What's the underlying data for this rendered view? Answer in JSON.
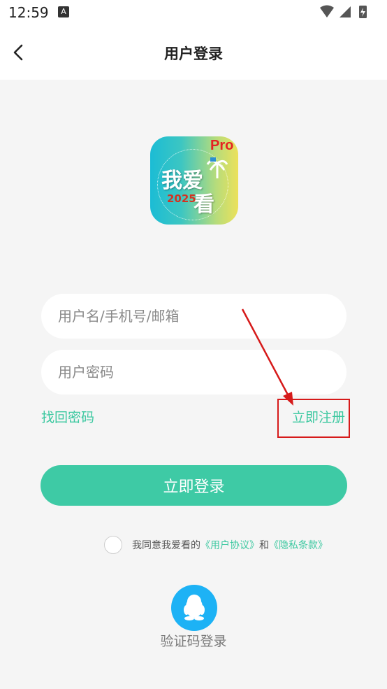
{
  "status_bar": {
    "time": "12:59",
    "notification_letter": "A"
  },
  "header": {
    "title": "用户登录"
  },
  "logo": {
    "pro_text": "Pro",
    "text_line1": "我爱",
    "text_line2": "看",
    "year": "2025"
  },
  "form": {
    "username_placeholder": "用户名/手机号/邮箱",
    "password_placeholder": "用户密码",
    "forgot_label": "找回密码",
    "register_label": "立即注册",
    "login_label": "立即登录"
  },
  "agreement": {
    "prefix": "我同意我爱看的",
    "user_agreement": "《用户协议》",
    "and": "和",
    "privacy_policy": "《隐私条款》"
  },
  "alt_login": {
    "code_login_label": "验证码登录"
  },
  "colors": {
    "accent": "#3ecaa5",
    "annotation_red": "#d61a1a",
    "qq_blue": "#1db2f5"
  }
}
